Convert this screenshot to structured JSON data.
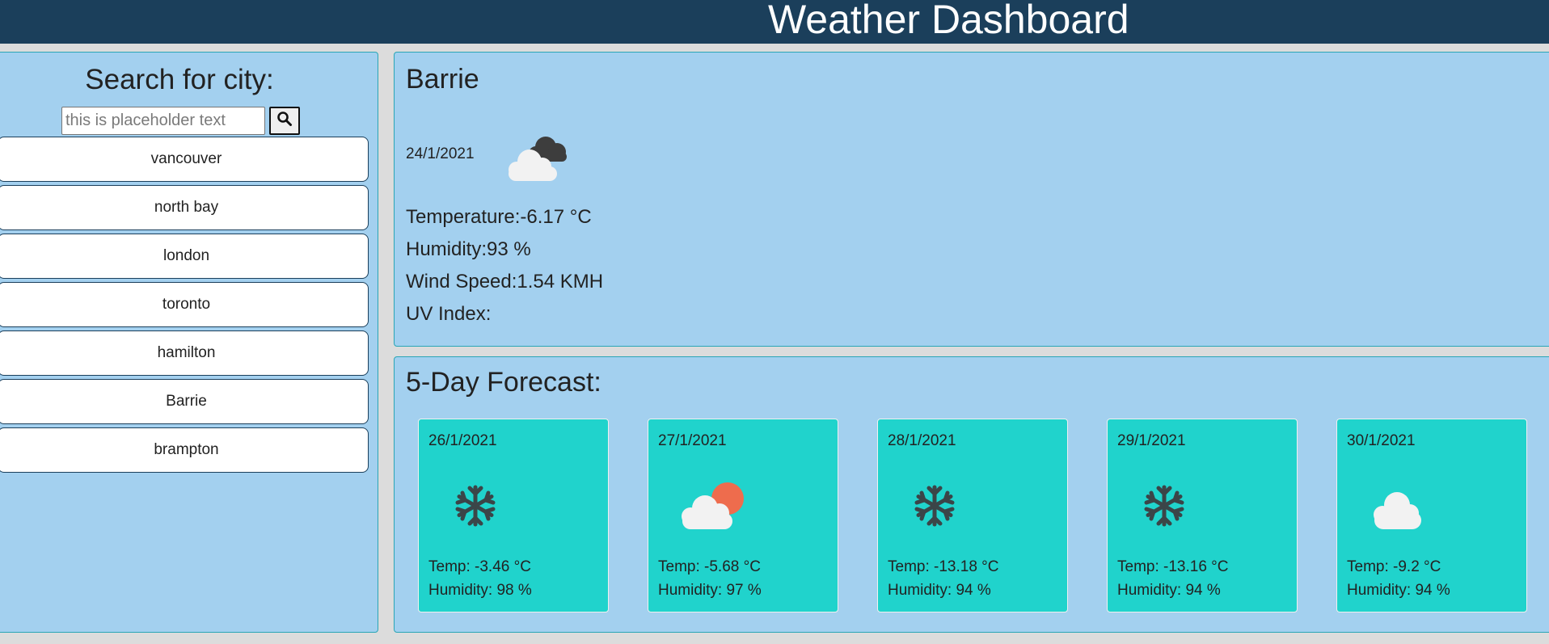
{
  "header": {
    "title": "Weather Dashboard"
  },
  "search": {
    "title": "Search for city:",
    "placeholder": "this is placeholder text",
    "button_icon": "search-icon"
  },
  "history": [
    "vancouver",
    "north bay",
    "london",
    "toronto",
    "hamilton",
    "Barrie",
    "brampton"
  ],
  "current": {
    "city": "Barrie",
    "date": "24/1/2021",
    "icon": "dark-cloud-icon",
    "temperature": "Temperature:-6.17 °C",
    "humidity": "Humidity:93 %",
    "wind": "Wind Speed:1.54 KMH",
    "uv": "UV Index:"
  },
  "forecast": {
    "title": "5-Day Forecast:",
    "days": [
      {
        "date": "26/1/2021",
        "icon": "snowflake-icon",
        "temp": "Temp: -3.46 °C",
        "humidity": "Humidity: 98 %"
      },
      {
        "date": "27/1/2021",
        "icon": "sun-cloud-icon",
        "temp": "Temp: -5.68 °C",
        "humidity": "Humidity: 97 %"
      },
      {
        "date": "28/1/2021",
        "icon": "snowflake-icon",
        "temp": "Temp: -13.18 °C",
        "humidity": "Humidity: 94 %"
      },
      {
        "date": "29/1/2021",
        "icon": "snowflake-icon",
        "temp": "Temp: -13.16 °C",
        "humidity": "Humidity: 94 %"
      },
      {
        "date": "30/1/2021",
        "icon": "cloud-icon",
        "temp": "Temp: -9.2 °C",
        "humidity": "Humidity: 94 %"
      }
    ]
  },
  "colors": {
    "header": "#1b3f5b",
    "panel": "#a3d0ef",
    "card": "#20d3cc",
    "panel_border": "#2aa6b6"
  }
}
